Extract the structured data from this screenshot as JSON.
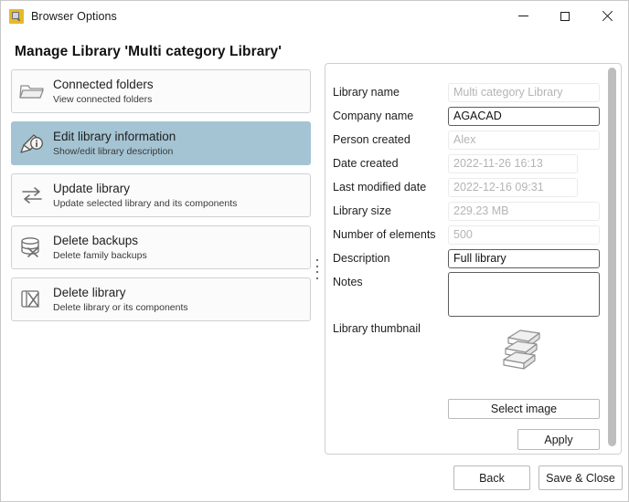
{
  "window": {
    "title": "Browser Options",
    "app_icon": "magnifier-app-icon",
    "controls": {
      "minimize": "minimize-icon",
      "maximize": "maximize-icon",
      "close": "close-icon"
    }
  },
  "heading": "Manage Library 'Multi category Library'",
  "sidebar": {
    "items": [
      {
        "icon": "folder-icon",
        "title": "Connected folders",
        "subtitle": "View connected folders",
        "selected": false
      },
      {
        "icon": "edit-info-icon",
        "title": "Edit library information",
        "subtitle": "Show/edit library description",
        "selected": true
      },
      {
        "icon": "update-arrows-icon",
        "title": "Update library",
        "subtitle": "Update selected library and its components",
        "selected": false
      },
      {
        "icon": "database-delete-icon",
        "title": "Delete backups",
        "subtitle": "Delete family backups",
        "selected": false
      },
      {
        "icon": "library-delete-icon",
        "title": "Delete library",
        "subtitle": "Delete library or its components",
        "selected": false
      }
    ],
    "splitter": "panel-splitter-handle"
  },
  "form": {
    "fields": [
      {
        "label": "Library name",
        "value": "Multi category Library",
        "editable": false,
        "width": "wide"
      },
      {
        "label": "Company name",
        "value": "AGACAD",
        "editable": true,
        "width": "wide"
      },
      {
        "label": "Person created",
        "value": "Alex",
        "editable": false,
        "width": "wide"
      },
      {
        "label": "Date created",
        "value": "2022-11-26 16:13",
        "editable": false,
        "width": "narrow"
      },
      {
        "label": "Last modified date",
        "value": "2022-12-16 09:31",
        "editable": false,
        "width": "narrow"
      },
      {
        "label": "Library size",
        "value": "229.23 MB",
        "editable": false,
        "width": "wide"
      },
      {
        "label": "Number of elements",
        "value": "500",
        "editable": false,
        "width": "wide"
      },
      {
        "label": "Description",
        "value": "Full library",
        "editable": true,
        "width": "wide"
      }
    ],
    "notes": {
      "label": "Notes",
      "value": ""
    },
    "thumbnail": {
      "label": "Library thumbnail",
      "icon": "books-stack-icon"
    },
    "select_image_label": "Select image",
    "apply_label": "Apply",
    "scrollbar": "form-scrollbar"
  },
  "footer": {
    "back_label": "Back",
    "save_close_label": "Save & Close"
  },
  "colors": {
    "selected_item": "#a4c4d3",
    "app_icon": "#e8b828",
    "disabled_text": "#b4b4b4",
    "editable_border": "#5e5e5e"
  }
}
